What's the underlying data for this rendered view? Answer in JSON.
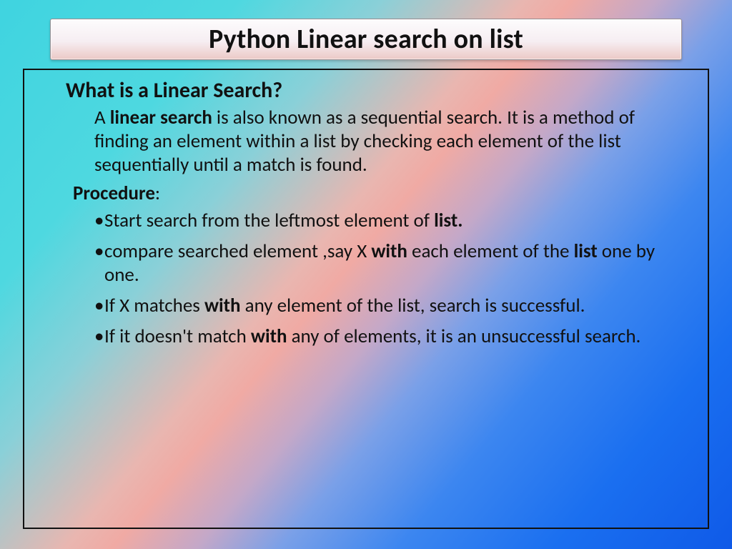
{
  "title": "Python Linear search on list",
  "heading": "What is a Linear Search?",
  "definition": {
    "pre": "A ",
    "bold": "linear search",
    "post": " is also known as a sequential search. It is a method of finding an element within a list by checking each element of the list sequentially until a match is found."
  },
  "procedure_label_bold": "Procedure",
  "procedure_label_colon": ":",
  "bullets": [
    {
      "t0": "Start search from the leftmost element of ",
      "b0": "list."
    },
    {
      "t0": "compare searched element ,say X ",
      "b0": "with",
      "t1": " each element of the ",
      "b1": "list",
      "t2": " one by one."
    },
    {
      "t0": "If X matches ",
      "b0": "with",
      "t1": " any element of the list, search is successful."
    },
    {
      "t0": "If it doesn't match ",
      "b0": "with",
      "t1": " any of elements, it is an unsuccessful search."
    }
  ]
}
